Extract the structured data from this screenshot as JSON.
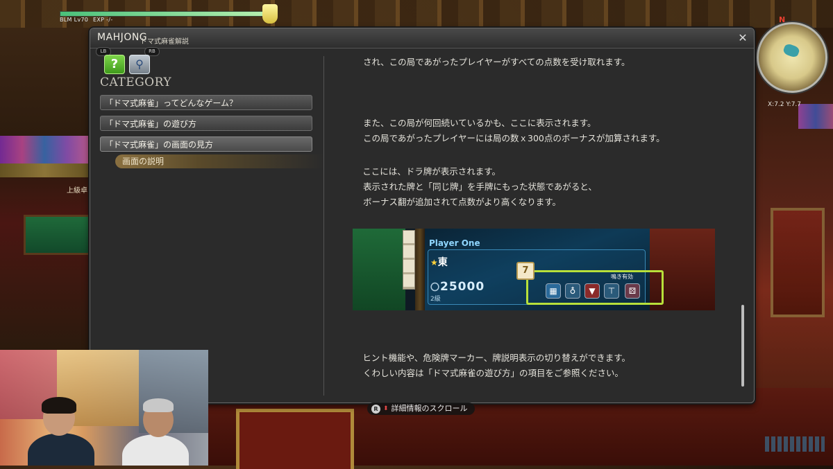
{
  "hud": {
    "job_level": "BLM Lv70",
    "exp": "EXP -/-",
    "coords": "X:7.2 Y:7.7",
    "compass": "N",
    "left_sign": "上級卓"
  },
  "window": {
    "title": "MAHJONG",
    "subtitle": "ドマ式麻雀解説",
    "close_icon": "✕"
  },
  "hints": {
    "lb": "LB",
    "rb": "RB"
  },
  "category": {
    "heading": "CATEGORY",
    "items": [
      "「ドマ式麻雀」ってどんなゲーム？",
      "「ドマ式麻雀」の遊び方",
      "「ドマ式麻雀」の画面の見方"
    ],
    "selected_index": 2,
    "sub_item": "画面の説明"
  },
  "content": {
    "para_top": "され、この局であがったプレイヤーがすべての点数を受け取れます。",
    "para_a": [
      "また、この局が何回続いているかも、ここに表示されます。",
      "この局であがったプレイヤーには局の数ｘ300点のボーナスが加算されます。"
    ],
    "para_b": [
      "⑥ここには、ドラ牌が表示されます。",
      "表示された牌と「同じ牌」を手牌にもった状態であがると、",
      "ボーナス翻が追加されて点数がより高くなります。"
    ],
    "para_c": [
      "⑦ヒント機能や、危険牌マーカー、牌説明表示の切り替えができます。",
      "くわしい内容は「ドマ式麻雀の遊び方」の項目をご参照ください。"
    ]
  },
  "screenshot": {
    "player_name": "Player One",
    "seat": "東",
    "score_prefix": "〇",
    "score": "25000",
    "rank": "2級",
    "badge": "7",
    "toggle_label": "鳴き有効",
    "icons": [
      "hint-icon",
      "danger-marker-icon",
      "triangle-icon",
      "tile-info-icon",
      "dice-icon"
    ]
  },
  "footer": {
    "scroll_button": "R",
    "scroll_hint": "詳細情報のスクロール"
  },
  "colors": {
    "accent_highlight": "#b8e03a",
    "help_button": "#5fbe2e",
    "sub_item": "#8a7040"
  }
}
